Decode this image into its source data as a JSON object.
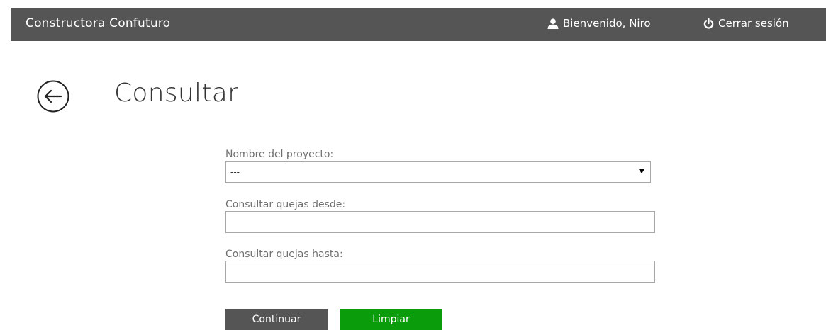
{
  "header": {
    "brand": "Constructora Confuturo",
    "welcome_text": "Bienvenido, Niro",
    "user_icon": "user-icon",
    "logout_label": "Cerrar sesión",
    "logout_icon": "power-icon",
    "background_color": "#555555"
  },
  "page": {
    "title": "Consultar",
    "back_icon": "back-arrow-circle-icon"
  },
  "form": {
    "project_label": "Nombre del proyecto:",
    "project_selected": "---",
    "from_label": "Consultar quejas desde:",
    "from_value": "",
    "to_label": "Consultar quejas hasta:",
    "to_value": ""
  },
  "actions": {
    "continue_label": "Continuar",
    "continue_color": "#555555",
    "clear_label": "Limpiar",
    "clear_color": "#0b9c0b"
  }
}
